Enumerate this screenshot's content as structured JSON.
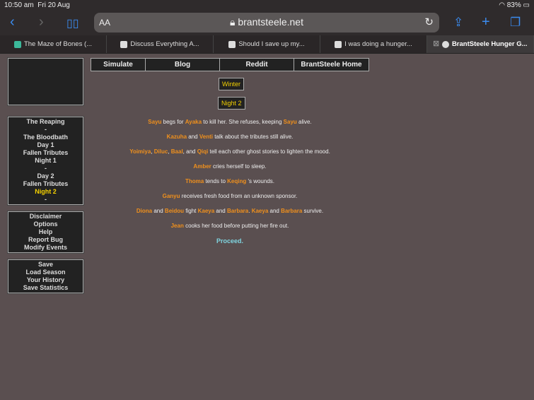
{
  "status": {
    "time": "10:50 am",
    "date": "Fri 20 Aug",
    "battery": "83%"
  },
  "browser": {
    "aa": "AA",
    "host": "brantsteele.net",
    "tabs": [
      {
        "title": "The Maze of Bones (..."
      },
      {
        "title": "Discuss Everything A..."
      },
      {
        "title": "Should I save up my..."
      },
      {
        "title": "I was doing a hunger..."
      },
      {
        "title": "BrantSteele Hunger G..."
      }
    ]
  },
  "nav": [
    "Simulate",
    "Blog",
    "Reddit",
    "BrantSteele Home"
  ],
  "sidebar": {
    "phases": [
      "The Reaping",
      "-",
      "The Bloodbath",
      "Day 1",
      "Fallen Tributes",
      "Night 1",
      "-",
      "Day 2",
      "Fallen Tributes",
      "Night 2",
      "-"
    ],
    "current_index": 9,
    "info": [
      "Disclaimer",
      "Options",
      "Help",
      "Report Bug",
      "Modify Events"
    ],
    "save": [
      "Save",
      "Load Season",
      "Your History",
      "Save Statistics"
    ]
  },
  "arena": "Winter",
  "phase": "Night 2",
  "events": [
    [
      [
        "Sayu",
        1
      ],
      [
        " begs for ",
        0
      ],
      [
        "Ayaka",
        1
      ],
      [
        " to kill her. She refuses, keeping ",
        0
      ],
      [
        "Sayu",
        1
      ],
      [
        " alive.",
        0
      ]
    ],
    [
      [
        "Kazuha",
        1
      ],
      [
        " and ",
        0
      ],
      [
        "Venti",
        1
      ],
      [
        " talk about the tributes still alive.",
        0
      ]
    ],
    [
      [
        "Yoimiya",
        1
      ],
      [
        ", ",
        0
      ],
      [
        "Diluc",
        1
      ],
      [
        ", ",
        0
      ],
      [
        "Baal",
        1
      ],
      [
        ", and ",
        0
      ],
      [
        "Qiqi",
        1
      ],
      [
        " tell each other ghost stories to lighten the mood.",
        0
      ]
    ],
    [
      [
        "Amber",
        1
      ],
      [
        " cries herself to sleep.",
        0
      ]
    ],
    [
      [
        "Thoma",
        1
      ],
      [
        " tends to ",
        0
      ],
      [
        "Keqing",
        1
      ],
      [
        " 's wounds.",
        0
      ]
    ],
    [
      [
        "Ganyu",
        1
      ],
      [
        " receives fresh food from an unknown sponsor.",
        0
      ]
    ],
    [
      [
        "Diona",
        1
      ],
      [
        " and ",
        0
      ],
      [
        "Beidou",
        1
      ],
      [
        " fight ",
        0
      ],
      [
        "Kaeya",
        1
      ],
      [
        " and ",
        0
      ],
      [
        "Barbara",
        1
      ],
      [
        ". ",
        0
      ],
      [
        "Kaeya",
        1
      ],
      [
        " and ",
        0
      ],
      [
        "Barbara",
        1
      ],
      [
        " survive.",
        0
      ]
    ],
    [
      [
        "Jean",
        1
      ],
      [
        " cooks her food before putting her fire out.",
        0
      ]
    ]
  ],
  "proceed": "Proceed."
}
